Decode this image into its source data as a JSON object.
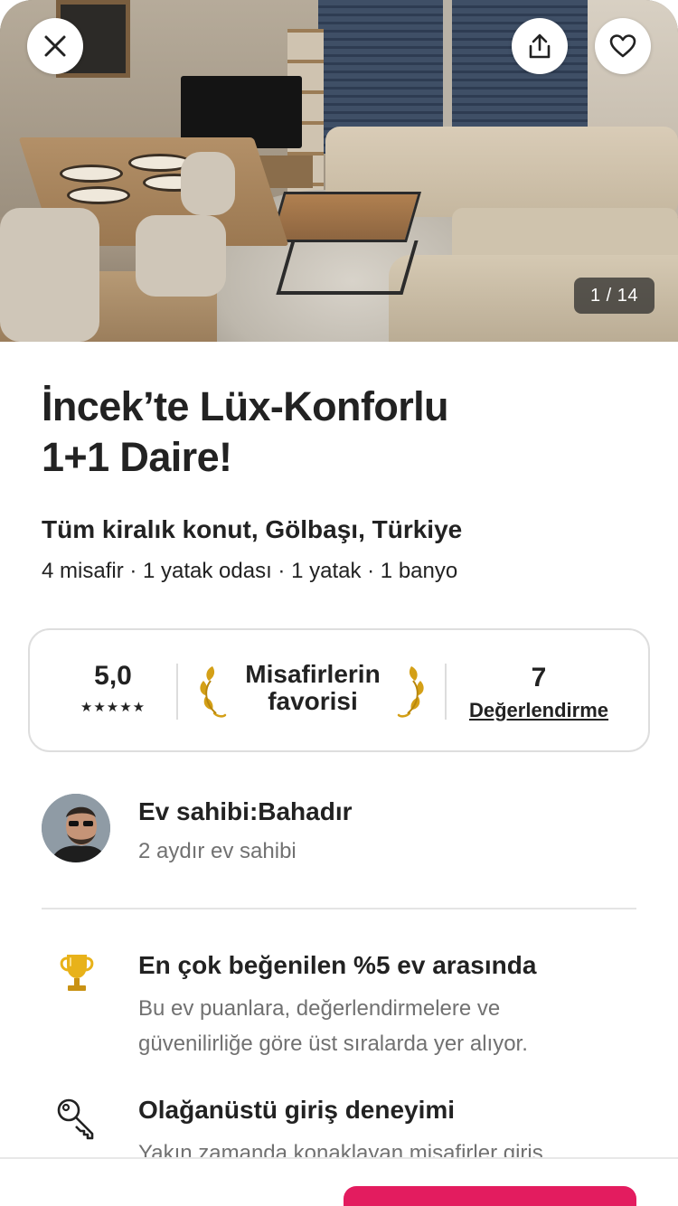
{
  "photo": {
    "counter": "1 / 14",
    "close_icon": "close-icon",
    "share_icon": "share-icon",
    "favorite_icon": "heart-icon"
  },
  "listing": {
    "title_line1": "İncek’te Lüx-Konforlu",
    "title_line2": "1+1 Daire!",
    "subtitle": "Tüm kiralık konut, Gölbaşı, Türkiye",
    "meta": "4 misafir · 1 yatak odası · 1 yatak · 1 banyo"
  },
  "rating_card": {
    "score": "5,0",
    "stars": "★★★★★",
    "star_count": 5,
    "badge_line1": "Misafirlerin",
    "badge_line2": "favorisi",
    "review_count": "7",
    "review_label": "Değerlendirme",
    "laurel_color": "#d4a017"
  },
  "host": {
    "name": "Ev sahibi:Bahadır",
    "since": "2 aydır ev sahibi"
  },
  "features": [
    {
      "icon": "trophy-icon",
      "heading": "En çok beğenilen %5 ev arasında",
      "body": "Bu ev puanlara, değerlendirmelere ve güvenilirliğe göre üst sıralarda yer alıyor."
    },
    {
      "icon": "key-icon",
      "heading": "Olağanüstü giriş deneyimi",
      "body": "Yakın zamanda konaklayan misafirler giriş"
    }
  ],
  "colors": {
    "accent": "#e31c5f",
    "text_primary": "#222222",
    "text_secondary": "#717171"
  }
}
